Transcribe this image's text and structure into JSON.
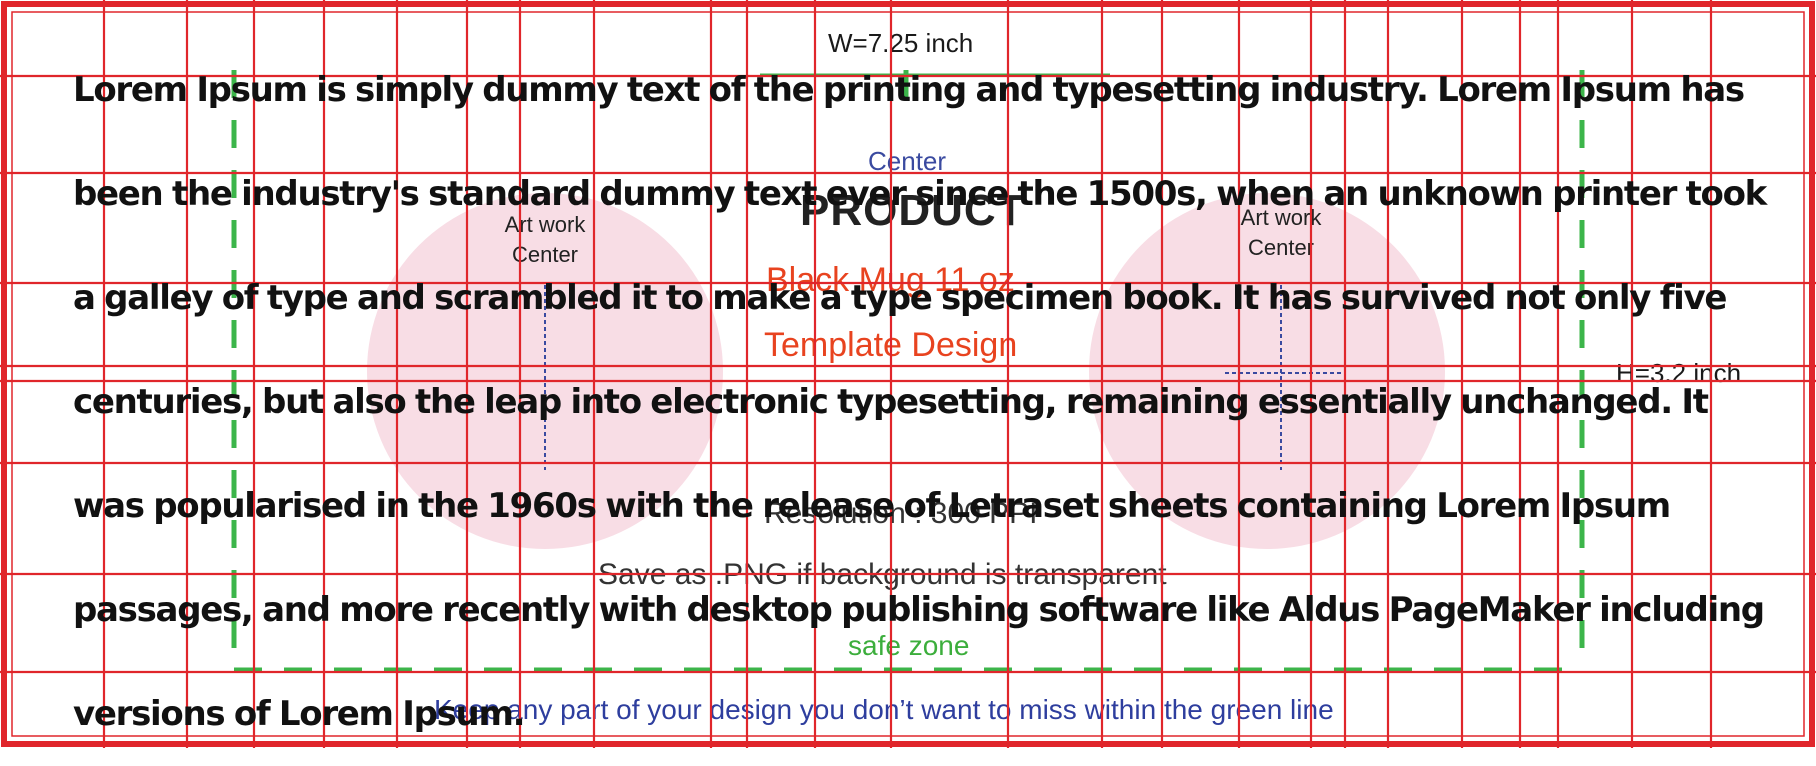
{
  "template": {
    "width_label": "W=7.25 inch",
    "height_label": "H=3.2 inch",
    "center_label": "Center",
    "product_title": "PRODUCT",
    "product_subtitle": "Black Mug 11 oz",
    "template_design": "Template Design",
    "artwork_left": {
      "line1": "Art work",
      "line2": "Center"
    },
    "artwork_right": {
      "line1": "Art work",
      "line2": "Center"
    },
    "resolution": "Resolution : 300 PPI",
    "save_as": "Save as .PNG if background is transparent",
    "safe_zone": "safe zone",
    "keep_note": "Keep any part of your design you don’t want to miss within the green line"
  },
  "colors": {
    "grid_red": "#e0262b",
    "safe_zone_green": "#3cb54a",
    "artwork_circle_pink": "#f8dde5",
    "center_line_blue": "#3a4aa0",
    "accent_orange": "#e8431f"
  },
  "overlay_text": "Lorem Ipsum is simply dummy text of the printing and typesetting industry. Lorem Ipsum has been the industry's standard dummy text ever since the 1500s, when an unknown printer took a galley of type and scrambled it to make a type specimen book. It has survived not only five centuries, but also the leap into electronic typesetting, remaining essentially unchanged. It was popularised in the 1960s with the release of Letraset sheets containing Lorem Ipsum passages, and more recently with desktop publishing software like Aldus PageMaker including versions of Lorem Ipsum."
}
